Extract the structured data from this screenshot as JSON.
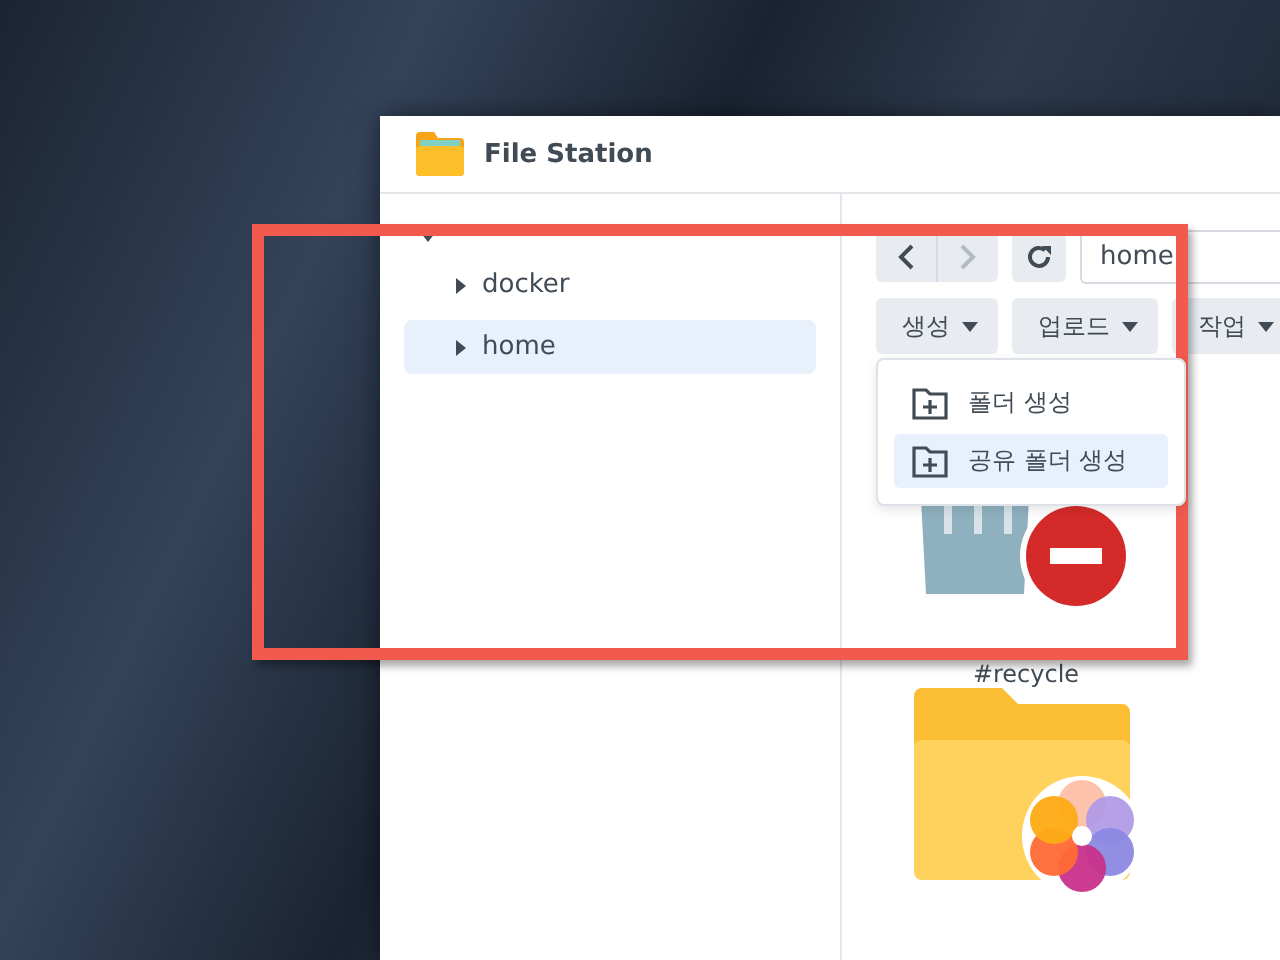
{
  "window": {
    "title": "File Station"
  },
  "tree": {
    "expanded": true,
    "children": [
      {
        "label": "docker",
        "selected": false
      },
      {
        "label": "home",
        "selected": true
      }
    ]
  },
  "path": "home",
  "actions": [
    "생성",
    "업로드",
    "작업"
  ],
  "menu": [
    {
      "label": "폴더 생성",
      "selected": false
    },
    {
      "label": "공유 폴더 생성",
      "selected": true
    }
  ],
  "files": [
    {
      "kind": "recycle",
      "name": "#recycle"
    },
    {
      "kind": "photo-folder"
    }
  ]
}
